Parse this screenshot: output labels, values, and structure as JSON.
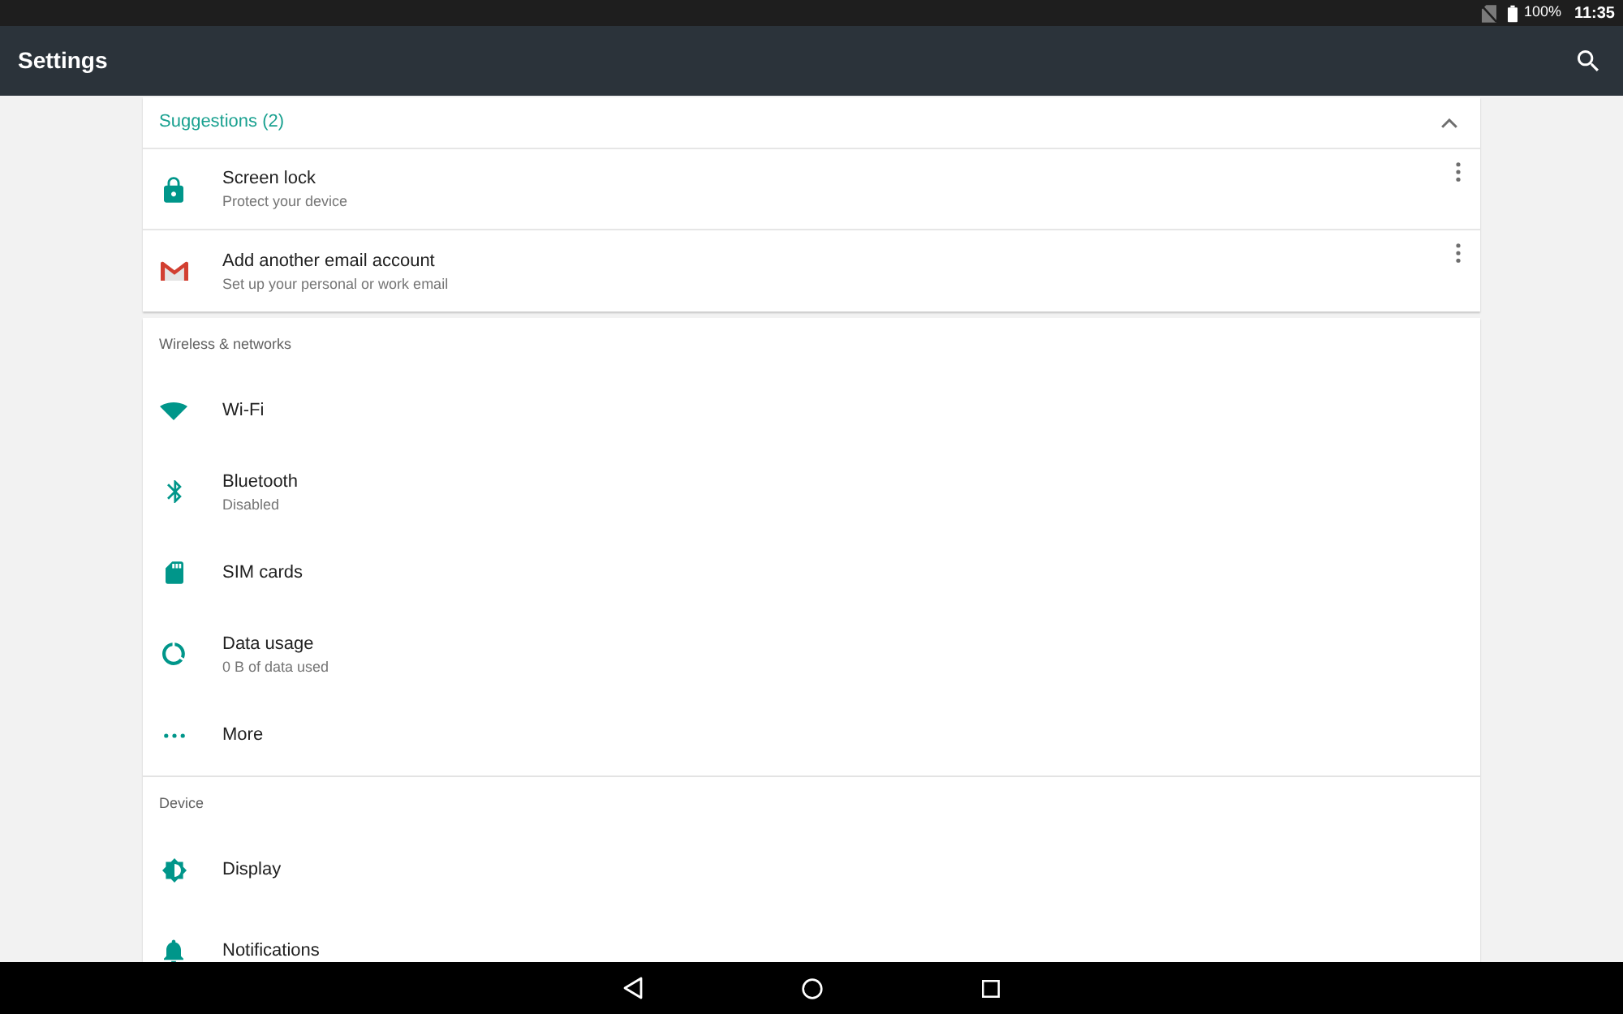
{
  "status_bar": {
    "battery_text": "100%",
    "time": "11:35"
  },
  "app_bar": {
    "title": "Settings"
  },
  "suggestions": {
    "title": "Suggestions (2)",
    "expanded": true,
    "items": [
      {
        "kind": "lock",
        "title": "Screen lock",
        "subtitle": "Protect your device"
      },
      {
        "kind": "mail",
        "title": "Add another email account",
        "subtitle": "Set up your personal or work email"
      }
    ]
  },
  "sections": [
    {
      "title": "Wireless & networks",
      "items": [
        {
          "kind": "wifi",
          "title": "Wi-Fi"
        },
        {
          "kind": "bluetooth",
          "title": "Bluetooth",
          "subtitle": "Disabled"
        },
        {
          "kind": "sim",
          "title": "SIM cards"
        },
        {
          "kind": "data",
          "title": "Data usage",
          "subtitle": "0 B of data used"
        },
        {
          "kind": "more",
          "title": "More"
        }
      ]
    },
    {
      "title": "Device",
      "items": [
        {
          "kind": "display",
          "title": "Display"
        },
        {
          "kind": "bell",
          "title": "Notifications"
        }
      ]
    }
  ]
}
